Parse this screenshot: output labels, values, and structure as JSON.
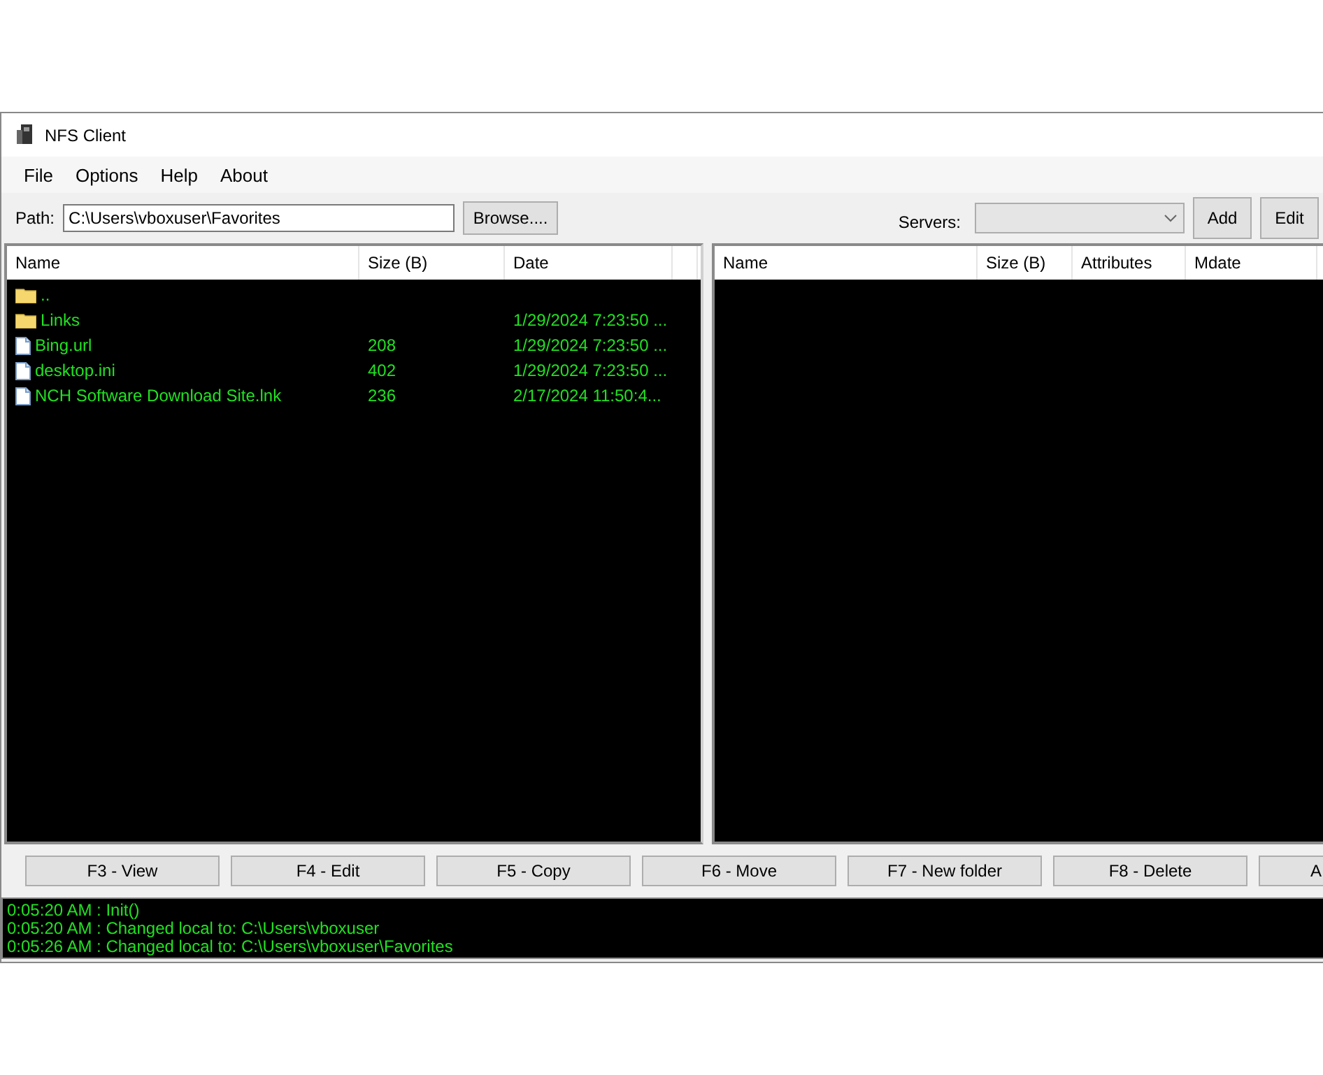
{
  "window": {
    "title": "NFS Client"
  },
  "menu": [
    "File",
    "Options",
    "Help",
    "About"
  ],
  "path": {
    "label": "Path:",
    "value": "C:\\Users\\vboxuser\\Favorites",
    "button": "Browse...."
  },
  "servers": {
    "label": "Servers:",
    "buttons": [
      "Add",
      "Edit"
    ]
  },
  "local_pane": {
    "columns": [
      "Name",
      "Size (B)",
      "Date"
    ],
    "rows": [
      {
        "kind": "folder",
        "name": ".."
      },
      {
        "kind": "folder",
        "name": "Links",
        "date": "1/29/2024 7:23:50 ..."
      },
      {
        "kind": "file",
        "name": "Bing.url",
        "size": "208",
        "date": "1/29/2024 7:23:50 ..."
      },
      {
        "kind": "file",
        "name": "desktop.ini",
        "size": "402",
        "date": "1/29/2024 7:23:50 ..."
      },
      {
        "kind": "file",
        "name": "NCH Software Download Site.lnk",
        "size": "236",
        "date": "2/17/2024 11:50:4..."
      }
    ]
  },
  "remote_pane": {
    "columns": [
      "Name",
      "Size (B)",
      "Attributes",
      "Mdate"
    ]
  },
  "actions": [
    "F3 - View",
    "F4 - Edit",
    "F5 - Copy",
    "F6 - Move",
    "F7 - New folder",
    "F8 - Delete",
    "A"
  ],
  "log": [
    "0:05:20 AM : Init()",
    "0:05:20 AM : Changed local to: C:\\Users\\vboxuser",
    "0:05:26 AM : Changed local to: C:\\Users\\vboxuser\\Favorites"
  ]
}
